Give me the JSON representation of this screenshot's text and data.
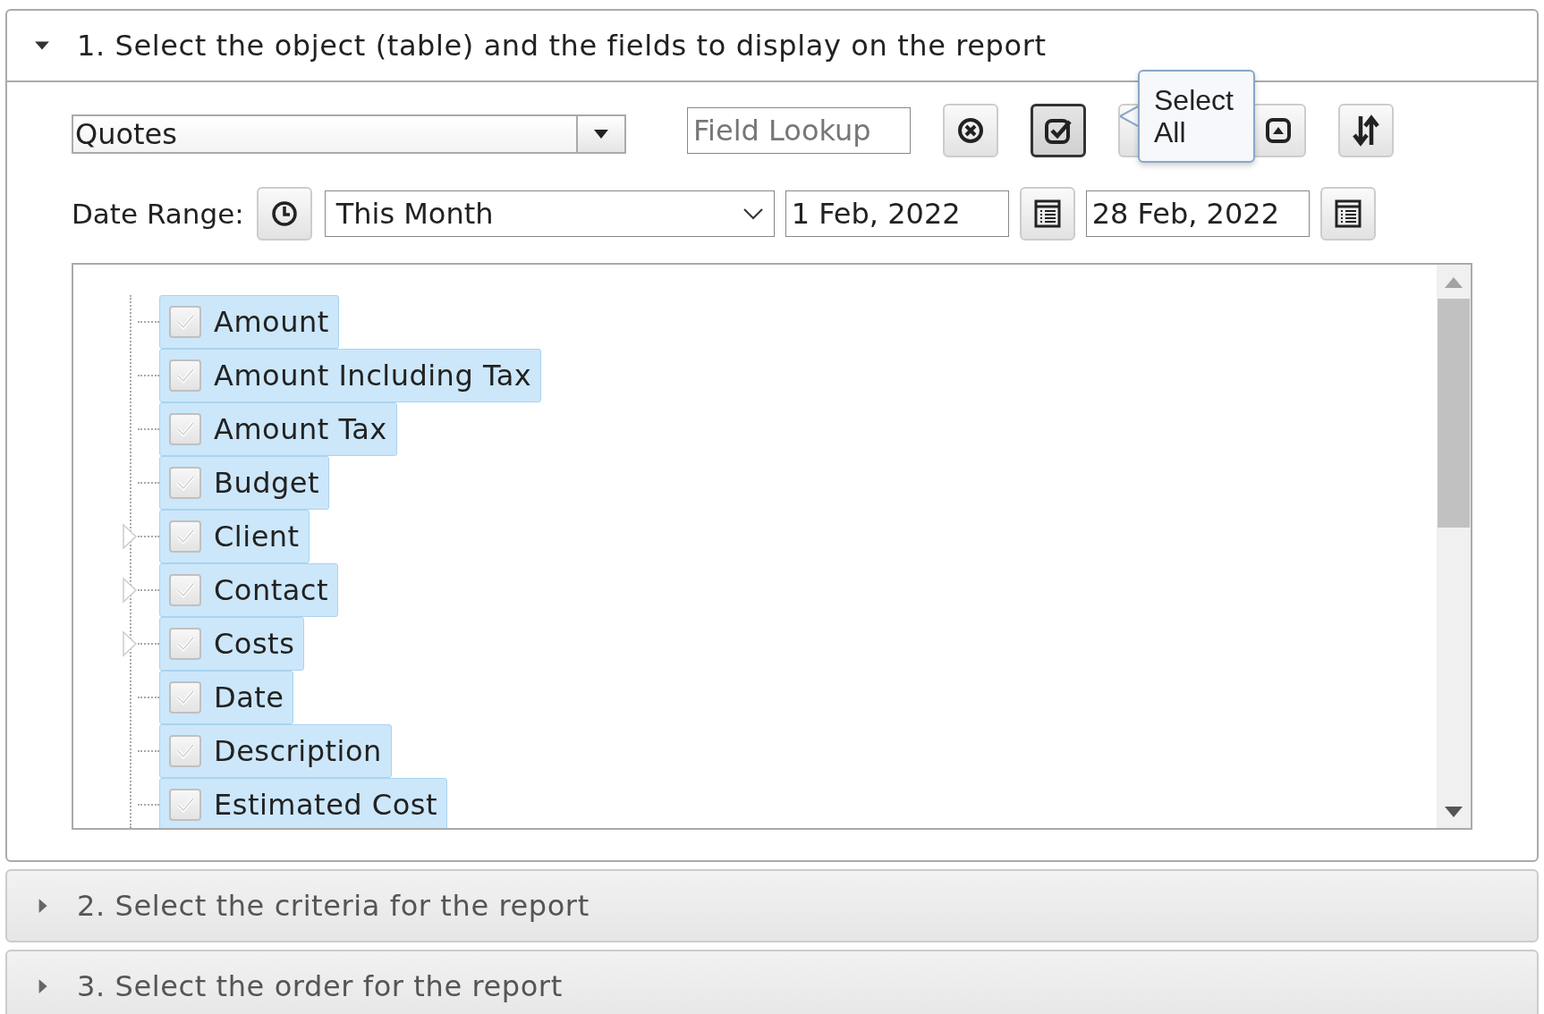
{
  "panels": [
    {
      "title": "1. Select the object (table) and the fields to display on the report",
      "expanded": true
    },
    {
      "title": "2. Select the criteria for the report",
      "expanded": false
    },
    {
      "title": "3. Select the order for the report",
      "expanded": false
    }
  ],
  "object_select": {
    "value": "Quotes"
  },
  "field_lookup": {
    "placeholder": "Field Lookup"
  },
  "tooltip": {
    "text": "Select All"
  },
  "date_range": {
    "label": "Date Range:",
    "period": "This Month",
    "from": "1 Feb, 2022",
    "to": "28 Feb, 2022"
  },
  "fields": [
    {
      "label": "Amount",
      "checked": true,
      "expandable": false
    },
    {
      "label": "Amount Including Tax",
      "checked": true,
      "expandable": false
    },
    {
      "label": "Amount Tax",
      "checked": true,
      "expandable": false
    },
    {
      "label": "Budget",
      "checked": true,
      "expandable": false
    },
    {
      "label": "Client",
      "checked": true,
      "expandable": true
    },
    {
      "label": "Contact",
      "checked": true,
      "expandable": true
    },
    {
      "label": "Costs",
      "checked": true,
      "expandable": true
    },
    {
      "label": "Date",
      "checked": true,
      "expandable": false
    },
    {
      "label": "Description",
      "checked": true,
      "expandable": false
    },
    {
      "label": "Estimated Cost",
      "checked": true,
      "expandable": false
    }
  ]
}
